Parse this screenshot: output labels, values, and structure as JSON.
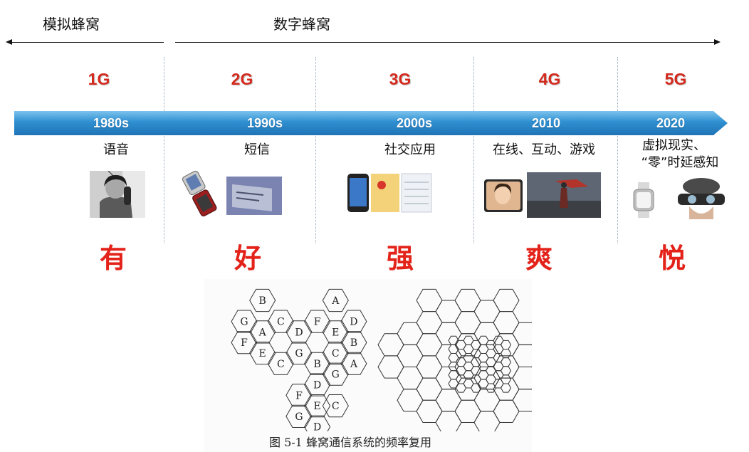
{
  "eras": {
    "analog": "模拟蜂窝",
    "digital": "数字蜂窝"
  },
  "generations": [
    {
      "gen": "1G",
      "year": "1980s",
      "feature": [
        "语音"
      ],
      "word": "有"
    },
    {
      "gen": "2G",
      "year": "1990s",
      "feature": [
        "短信"
      ],
      "word": "好"
    },
    {
      "gen": "3G",
      "year": "2000s",
      "feature": [
        "社交应用"
      ],
      "word": "强"
    },
    {
      "gen": "4G",
      "year": "2010",
      "feature": [
        "在线、互动、游戏"
      ],
      "word": "爽"
    },
    {
      "gen": "5G",
      "year": "2020",
      "feature": [
        "虚拟现实、",
        "“零”时延感知"
      ],
      "word": "悦"
    }
  ],
  "figure": {
    "caption": "图 5-1    蜂窝通信系统的频率复用",
    "cells": [
      "B",
      "C",
      "G",
      "A",
      "D",
      "F",
      "E",
      "G",
      "C",
      "B",
      "A",
      "F",
      "D",
      "E",
      "B",
      "C",
      "G",
      "A",
      "D",
      "F",
      "E",
      "G",
      "C",
      "D"
    ]
  },
  "colors": {
    "accent_red": "#e3231a",
    "gen_red": "#d42a1e",
    "band_blue": "#2f8fd0"
  }
}
